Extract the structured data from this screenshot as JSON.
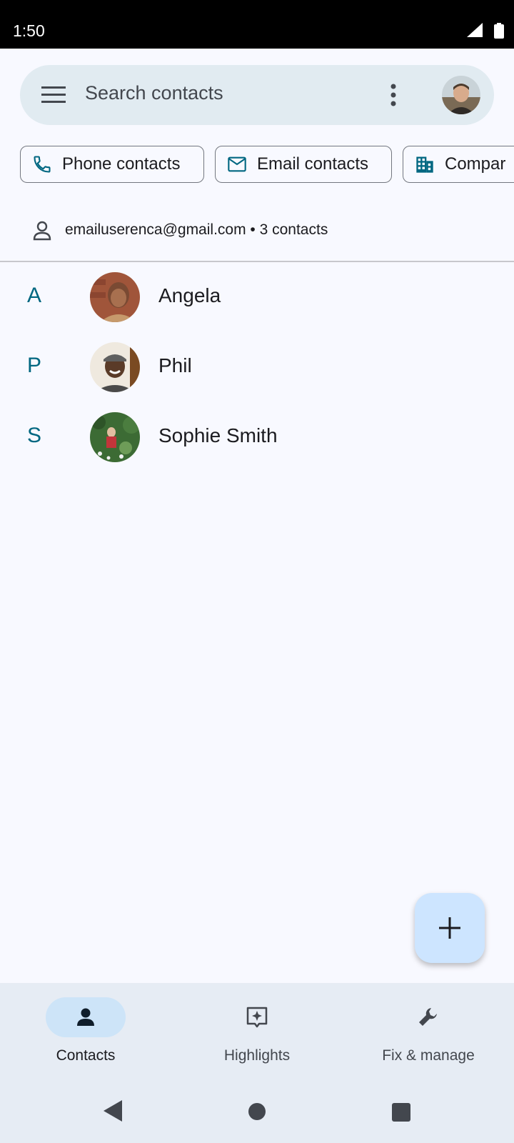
{
  "status_bar": {
    "time": "1:50"
  },
  "search": {
    "placeholder": "Search contacts"
  },
  "chips": [
    {
      "label": "Phone contacts",
      "icon": "phone-icon"
    },
    {
      "label": "Email contacts",
      "icon": "mail-icon"
    },
    {
      "label": "Compar",
      "icon": "building-icon"
    }
  ],
  "account": {
    "text": "emailuserenca@gmail.com • 3 contacts"
  },
  "contacts": [
    {
      "letter": "A",
      "name": "Angela"
    },
    {
      "letter": "P",
      "name": "Phil"
    },
    {
      "letter": "S",
      "name": "Sophie Smith"
    }
  ],
  "bottom_nav": [
    {
      "label": "Contacts",
      "icon": "person-icon",
      "active": true
    },
    {
      "label": "Highlights",
      "icon": "sparkle-icon",
      "active": false
    },
    {
      "label": "Fix & manage",
      "icon": "wrench-icon",
      "active": false
    }
  ],
  "colors": {
    "accent": "#006781",
    "fab": "#cde5ff",
    "search_bg": "#e1ebf1",
    "nav_bg": "#e6ecf4"
  }
}
